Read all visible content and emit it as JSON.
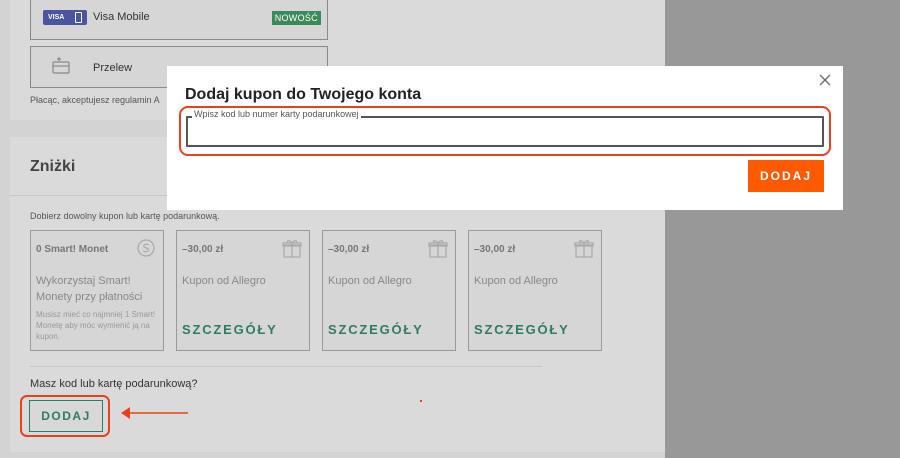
{
  "payment": {
    "visa": {
      "logo": "VISA",
      "label": "Visa Mobile",
      "badge": "NOWOŚĆ"
    },
    "transfer": {
      "label": "Przelew"
    },
    "terms": "Płacąc, akceptujesz regulamin A"
  },
  "discounts": {
    "title": "Zniżki",
    "help": "Dobierz dowolny kupon lub kartę podarunkową.",
    "coupons": [
      {
        "title": "0 Smart! Monet",
        "icon": "smart-coin-icon",
        "subtitle": "Wykorzystaj Smart! Monety przy płatności",
        "note": "Musisz mieć co najmniej 1 Smart! Monetę aby móc wymienić ją na kupon."
      },
      {
        "title": "–30,00 zł",
        "icon": "gift-icon",
        "subtitle": "Kupon od Allegro",
        "link": "SZCZEGÓŁY"
      },
      {
        "title": "–30,00 zł",
        "icon": "gift-icon",
        "subtitle": "Kupon od Allegro",
        "link": "SZCZEGÓŁY"
      },
      {
        "title": "–30,00 zł",
        "icon": "gift-icon",
        "subtitle": "Kupon od Allegro",
        "link": "SZCZEGÓŁY"
      }
    ],
    "has_code": "Masz kod lub kartę podarunkową?",
    "add_button": "DODAJ"
  },
  "modal": {
    "title": "Dodaj kupon do Twojego konta",
    "input_label": "Wpisz kod lub numer karty podarunkowej",
    "input_value": "",
    "add_button": "DODAJ",
    "close_icon": "close-icon"
  },
  "colors": {
    "accent": "#ff5a00",
    "green": "#2e7d62",
    "highlight": "#e8421d"
  }
}
